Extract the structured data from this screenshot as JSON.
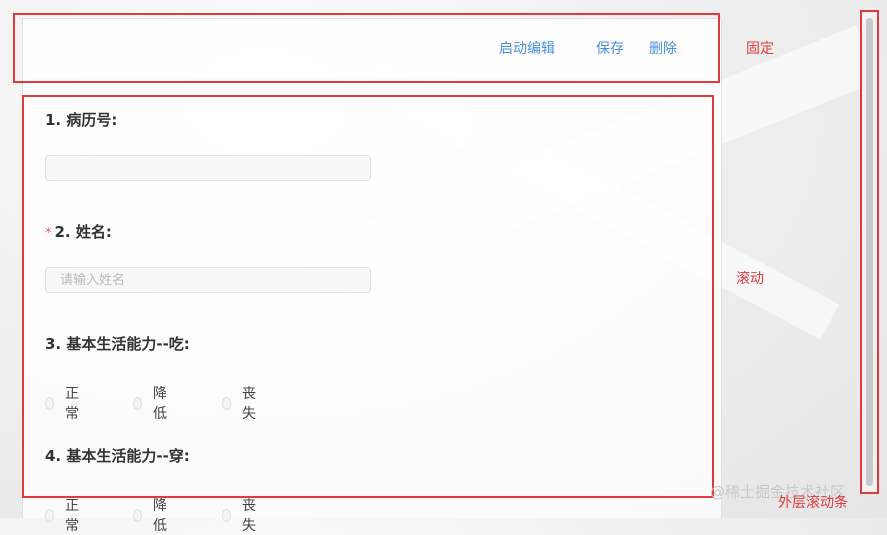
{
  "toolbar": {
    "edit_label": "启动编辑",
    "save_label": "保存",
    "delete_label": "删除"
  },
  "form": {
    "q1": {
      "label": "1. 病历号:",
      "value": "",
      "placeholder": ""
    },
    "q2": {
      "required_mark": "*",
      "label": "2. 姓名:",
      "placeholder": "请输入姓名"
    },
    "q3": {
      "label": "3. 基本生活能力--吃:",
      "options": [
        "正常",
        "降低",
        "丧失"
      ]
    },
    "q4": {
      "label": "4. 基本生活能力--穿:",
      "options": [
        "正常",
        "降低",
        "丧失"
      ]
    }
  },
  "annotations": {
    "fixed": "固定",
    "scroll": "滚动",
    "outer_scrollbar": "外层滚动条"
  },
  "watermark": "@稀土掘金技术社区",
  "colors": {
    "annotation": "#e0393e",
    "link": "#4a90d9"
  }
}
